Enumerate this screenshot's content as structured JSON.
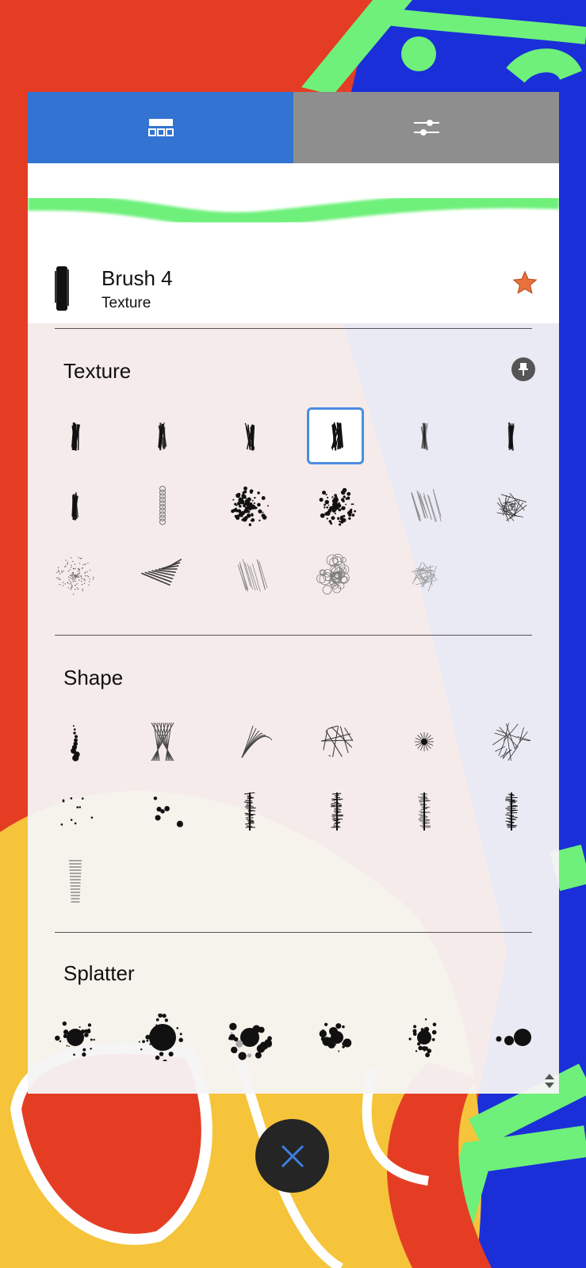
{
  "tabs": [
    {
      "name": "brush-library-tab",
      "icon": "brush-grid-icon",
      "active": true
    },
    {
      "name": "brush-settings-tab",
      "icon": "sliders-icon",
      "active": false
    }
  ],
  "current_brush": {
    "name": "Brush 4",
    "category": "Texture",
    "favorite_icon": "star-icon"
  },
  "sections": [
    {
      "title": "Texture",
      "pin_icon": "pin-icon",
      "count": 17,
      "selected_index": 3
    },
    {
      "title": "Shape",
      "count": 13
    },
    {
      "title": "Splatter",
      "count": 6
    }
  ],
  "colors": {
    "accent_blue": "#3373d1",
    "selection_border": "#4a8de0",
    "stroke_green": "#6ef07a",
    "star_orange": "#e8713d",
    "close_x": "#3d7fe0"
  },
  "close_button_icon": "close-icon",
  "resize_icon": "resize-handle-icon"
}
